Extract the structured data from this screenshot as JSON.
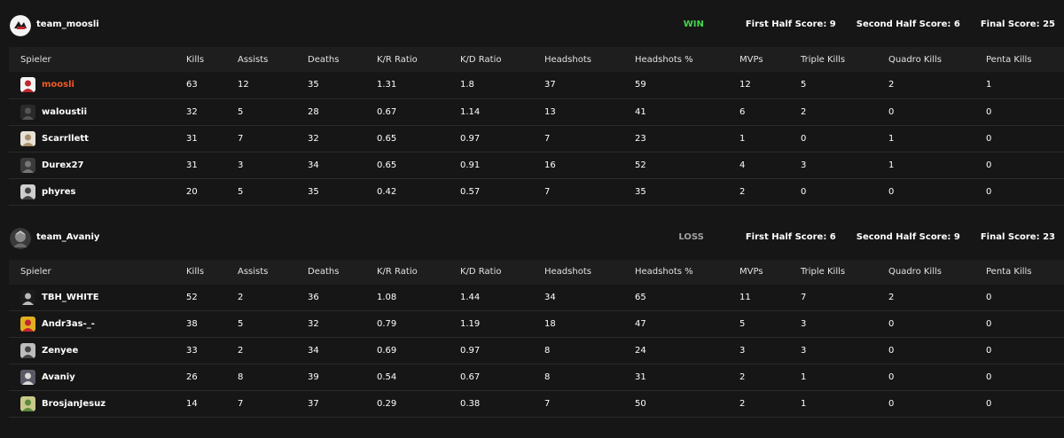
{
  "columns": [
    "Spieler",
    "Kills",
    "Assists",
    "Deaths",
    "K/R Ratio",
    "K/D Ratio",
    "Headshots",
    "Headshots %",
    "MVPs",
    "Triple Kills",
    "Quadro Kills",
    "Penta Kills"
  ],
  "teams": [
    {
      "name": "team_moosli",
      "result": "WIN",
      "first_half": "First Half Score: 9",
      "second_half": "Second Half Score: 6",
      "final": "Final Score: 25",
      "players": [
        {
          "name": "moosli",
          "highlight": true,
          "stats": [
            "63",
            "12",
            "35",
            "1.31",
            "1.8",
            "37",
            "59",
            "12",
            "5",
            "2",
            "1"
          ]
        },
        {
          "name": "waloustii",
          "highlight": false,
          "stats": [
            "32",
            "5",
            "28",
            "0.67",
            "1.14",
            "13",
            "41",
            "6",
            "2",
            "0",
            "0"
          ]
        },
        {
          "name": "Scarrllett",
          "highlight": false,
          "stats": [
            "31",
            "7",
            "32",
            "0.65",
            "0.97",
            "7",
            "23",
            "1",
            "0",
            "1",
            "0"
          ]
        },
        {
          "name": "Durex27",
          "highlight": false,
          "stats": [
            "31",
            "3",
            "34",
            "0.65",
            "0.91",
            "16",
            "52",
            "4",
            "3",
            "1",
            "0"
          ]
        },
        {
          "name": "phyres",
          "highlight": false,
          "stats": [
            "20",
            "5",
            "35",
            "0.42",
            "0.57",
            "7",
            "35",
            "2",
            "0",
            "0",
            "0"
          ]
        }
      ]
    },
    {
      "name": "team_Avaniy",
      "result": "LOSS",
      "first_half": "First Half Score: 6",
      "second_half": "Second Half Score: 9",
      "final": "Final Score: 23",
      "players": [
        {
          "name": "TBH_WHITE",
          "highlight": false,
          "stats": [
            "52",
            "2",
            "36",
            "1.08",
            "1.44",
            "34",
            "65",
            "11",
            "7",
            "2",
            "0"
          ]
        },
        {
          "name": "Andr3as-_-",
          "highlight": false,
          "stats": [
            "38",
            "5",
            "32",
            "0.79",
            "1.19",
            "18",
            "47",
            "5",
            "3",
            "0",
            "0"
          ]
        },
        {
          "name": "Zenyee",
          "highlight": false,
          "stats": [
            "33",
            "2",
            "34",
            "0.69",
            "0.97",
            "8",
            "24",
            "3",
            "3",
            "0",
            "0"
          ]
        },
        {
          "name": "Avaniy",
          "highlight": false,
          "stats": [
            "26",
            "8",
            "39",
            "0.54",
            "0.67",
            "8",
            "31",
            "2",
            "1",
            "0",
            "0"
          ]
        },
        {
          "name": "BrosjanJesuz",
          "highlight": false,
          "stats": [
            "14",
            "7",
            "37",
            "0.29",
            "0.38",
            "7",
            "50",
            "2",
            "1",
            "0",
            "0"
          ]
        }
      ]
    }
  ],
  "colors": {
    "win": "#45d64d",
    "loss": "#a0a0a0",
    "self_player": "#f05a28"
  },
  "icons": {
    "team_avatar": "team-logo-icon",
    "player_avatar": "player-avatar-icon"
  }
}
